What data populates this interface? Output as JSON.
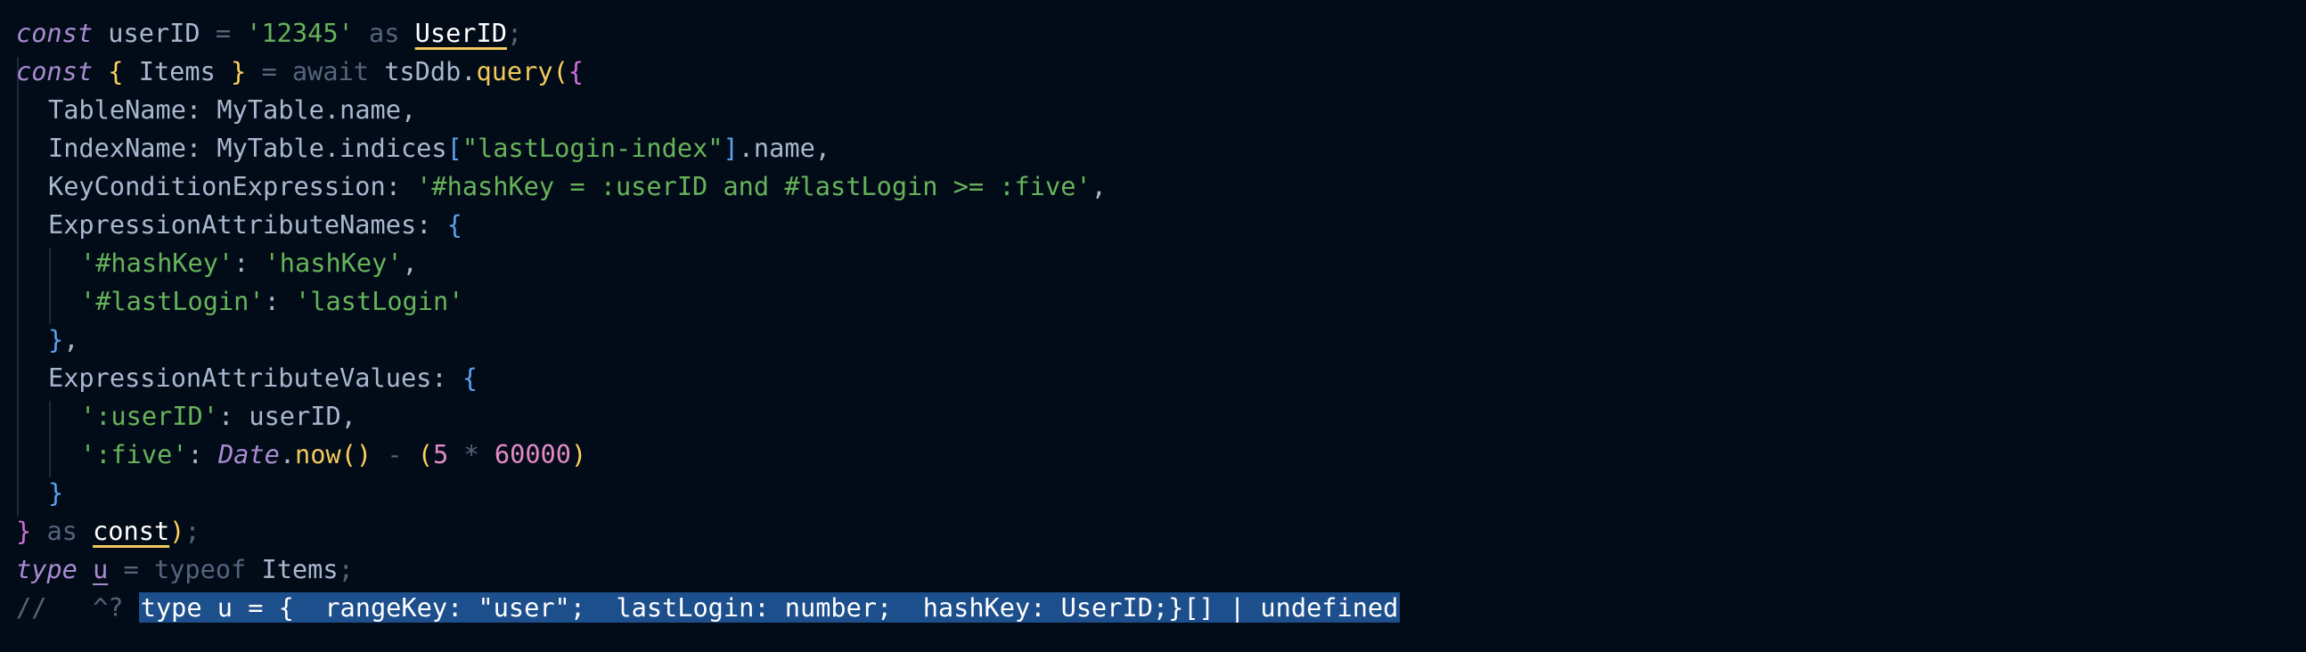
{
  "colors": {
    "background": "#020c18",
    "keyword": "#a98bd1",
    "string": "#67b35a",
    "number": "#e38ac6",
    "function": "#f1c95d",
    "selection": "#1d4f8c"
  },
  "code": {
    "l1": {
      "kw": "const",
      "name": "userID",
      "eq": "=",
      "str": "'12345'",
      "as": "as",
      "type": "UserID",
      "semi": ";"
    },
    "l2": {
      "kw": "const",
      "ob": "{",
      "items": "Items",
      "cb": "}",
      "eq": "=",
      "await": "await",
      "obj": "tsDdb",
      "dot": ".",
      "fn": "query",
      "p": "(",
      "b": "{"
    },
    "l3": {
      "key": "TableName:",
      "obj": "MyTable",
      "prop": ".name,",
      "comma": ""
    },
    "l4": {
      "key": "IndexName:",
      "obj": "MyTable",
      "prop": ".indices",
      "lb": "[",
      "str": "\"lastLogin-index\"",
      "rb": "]",
      "rest": ".name,"
    },
    "l5": {
      "key": "KeyConditionExpression:",
      "str": "'#hashKey = :userID and #lastLogin >= :five'",
      "comma": ","
    },
    "l6": {
      "key": "ExpressionAttributeNames:",
      "b": "{"
    },
    "l7": {
      "str1": "'#hashKey'",
      "colon": ":",
      "str2": "'hashKey'",
      "comma": ","
    },
    "l8": {
      "str1": "'#lastLogin'",
      "colon": ":",
      "str2": "'lastLogin'"
    },
    "l9": {
      "b": "}",
      "comma": ","
    },
    "l10": {
      "key": "ExpressionAttributeValues:",
      "b": "{"
    },
    "l11": {
      "str1": "':userID'",
      "colon": ":",
      "val": "userID,"
    },
    "l12": {
      "str1": "':five'",
      "colon": ":",
      "date": "Date",
      "dot": ".",
      "fn": "now",
      "par": "()",
      "minus": "-",
      "lp": "(",
      "n1": "5",
      "mul": "*",
      "n2": "60000",
      "rp": ")"
    },
    "l13": {
      "b": "}"
    },
    "l14": {
      "cb": "}",
      "as": "as",
      "const": "const",
      "rp": ")",
      "semi": ";"
    },
    "l15": {
      "kw": "type",
      "name": "u",
      "eq": "=",
      "typeof": "typeof",
      "items": "Items",
      "semi": ";"
    },
    "l16": {
      "comment": "//   ^?",
      "tooltip": "type u = {  rangeKey: \"user\";  lastLogin: number;  hashKey: UserID;}[] | undefined"
    }
  }
}
